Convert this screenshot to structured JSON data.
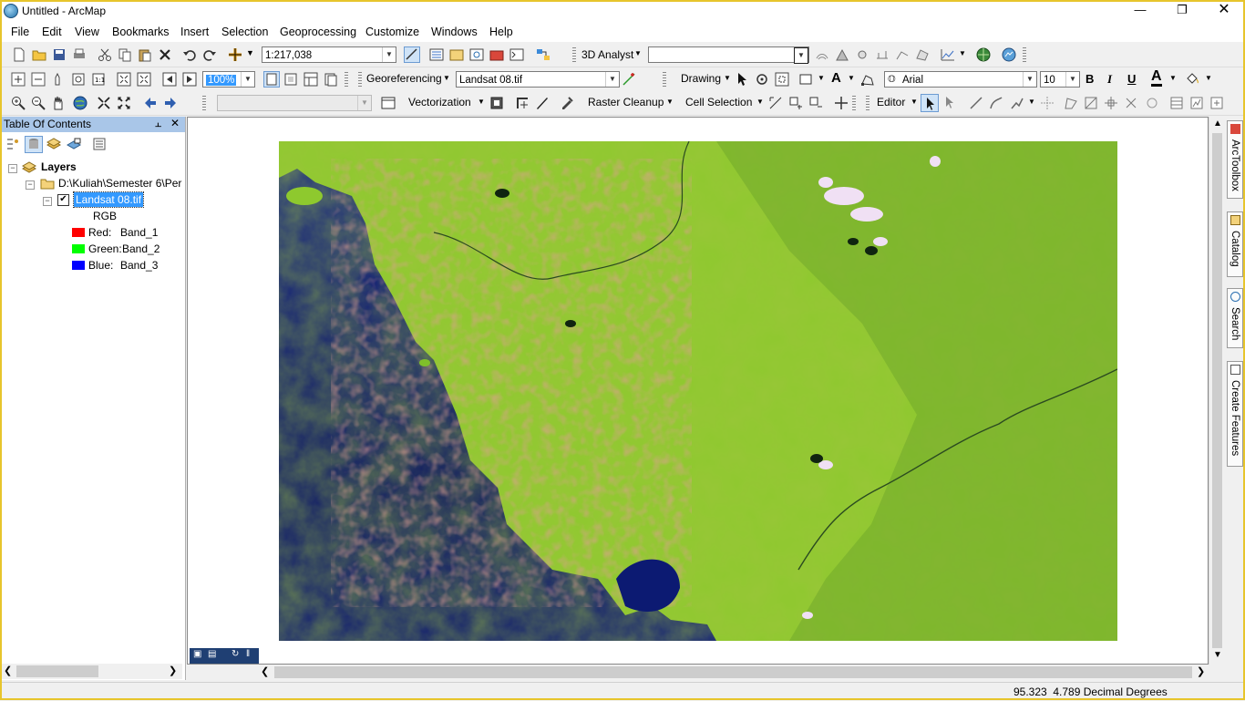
{
  "window": {
    "title": "Untitled - ArcMap"
  },
  "menu": [
    "File",
    "Edit",
    "View",
    "Bookmarks",
    "Insert",
    "Selection",
    "Geoprocessing",
    "Customize",
    "Windows",
    "Help"
  ],
  "toolbar1": {
    "scale": "1:217,038",
    "analyst_label": "3D Analyst",
    "analyst_layer": ""
  },
  "toolbar2": {
    "zoom_percent": "100%",
    "georef_label": "Georeferencing",
    "georef_layer": "Landsat 08.tif",
    "drawing_label": "Drawing",
    "font_name": "Arial",
    "font_size": "10",
    "bold": "B",
    "italic": "I",
    "underline": "U",
    "text_tool": "A"
  },
  "toolbar3": {
    "empty_combo": "",
    "vectorization_label": "Vectorization",
    "raster_cleanup_label": "Raster Cleanup",
    "cell_selection_label": "Cell Selection",
    "editor_label": "Editor"
  },
  "toc": {
    "title": "Table Of Contents",
    "root": "Layers",
    "folder": "D:\\Kuliah\\Semester 6\\Per",
    "layer": "Landsat 08.tif",
    "renderer": "RGB",
    "bands": [
      {
        "channel": "Red:",
        "band": "Band_1",
        "color": "#ff0000"
      },
      {
        "channel": "Green:",
        "band": "Band_2",
        "color": "#00ff00"
      },
      {
        "channel": "Blue:",
        "band": "Band_3",
        "color": "#0000ff"
      }
    ]
  },
  "right_dock": [
    "ArcToolbox",
    "Catalog",
    "Search",
    "Create Features"
  ],
  "status": {
    "coordinates": "95.323  4.789 Decimal Degrees"
  },
  "colors": {
    "toc_header": "#a9c6e8",
    "selected": "#3399ff",
    "frame": "#e7c52c"
  }
}
